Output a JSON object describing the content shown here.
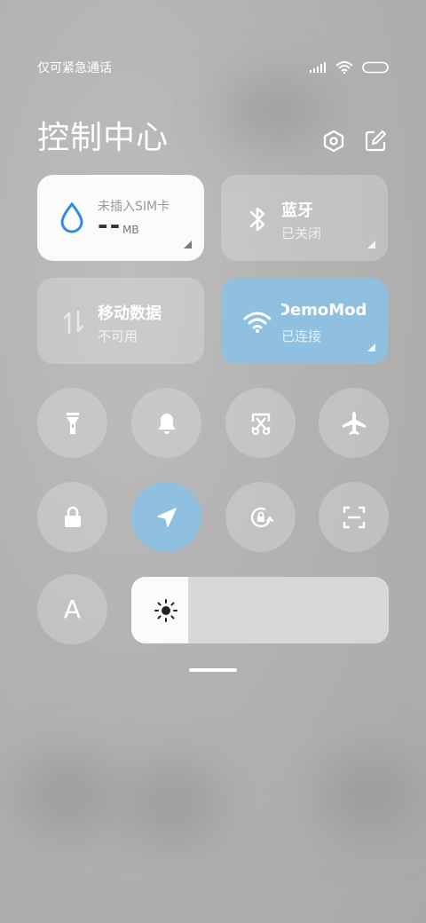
{
  "status_bar": {
    "carrier_text": "仅可紧急通话",
    "icons": [
      "signal-icon",
      "wifi-icon",
      "battery-icon"
    ]
  },
  "header": {
    "title": "控制中心",
    "icons": [
      "settings-icon",
      "edit-icon"
    ]
  },
  "tiles": {
    "data_usage": {
      "subtitle": "未插入SIM卡",
      "value": "--",
      "unit": "MB",
      "icon": "water-drop-icon"
    },
    "bluetooth": {
      "title": "蓝牙",
      "status": "已关闭",
      "icon": "bluetooth-icon"
    },
    "mobile_data": {
      "title": "移动数据",
      "status": "不可用",
      "icon": "data-arrows-icon"
    },
    "wifi": {
      "title": "DemoMod",
      "status": "已连接",
      "icon": "wifi-icon"
    }
  },
  "toggles_row1": [
    "flashlight-icon",
    "bell-icon",
    "screenshot-icon",
    "airplane-icon"
  ],
  "toggles_row2": [
    "lock-icon",
    "location-icon",
    "rotation-lock-icon",
    "scan-icon"
  ],
  "bottom_row": {
    "auto_brightness_label": "A",
    "brightness_level": 0.22,
    "icon": "sun-icon"
  },
  "colors": {
    "accent_blue": "#8fc0e0",
    "drop_blue": "#2e8de6",
    "tile_white": "#fbfbfb"
  }
}
